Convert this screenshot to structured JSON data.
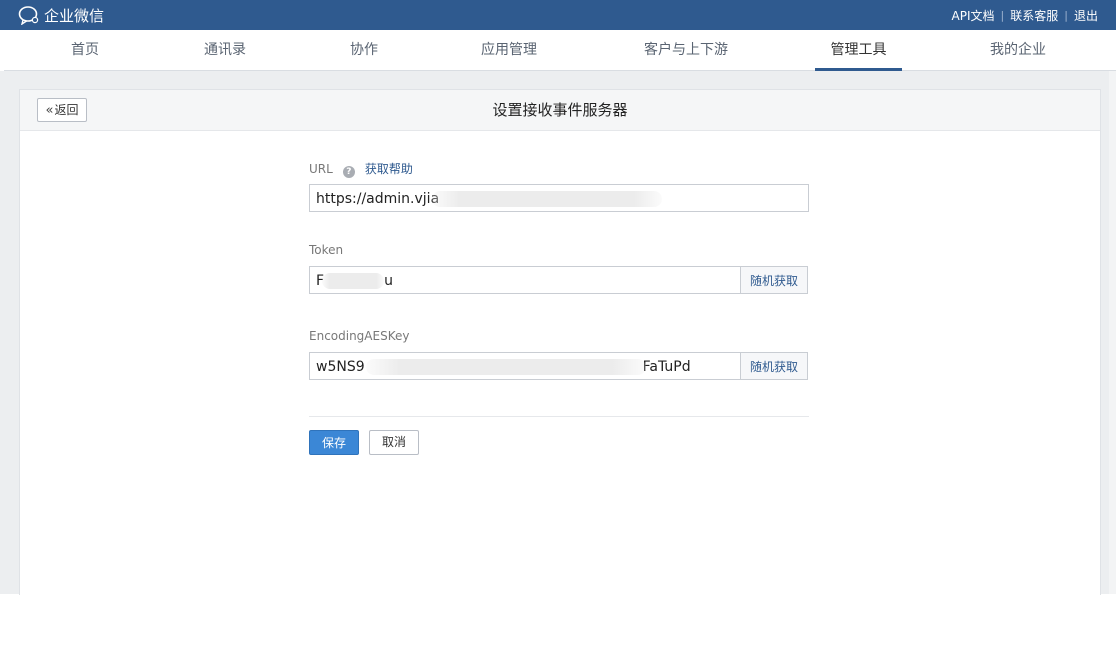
{
  "topbar": {
    "brand": "企业微信",
    "links": [
      "API文档",
      "联系客服",
      "退出"
    ],
    "separator": "|"
  },
  "nav": {
    "items": [
      {
        "label": "首页"
      },
      {
        "label": "通讯录"
      },
      {
        "label": "协作"
      },
      {
        "label": "应用管理"
      },
      {
        "label": "客户与上下游"
      },
      {
        "label": "管理工具"
      },
      {
        "label": "我的企业"
      }
    ],
    "active": "管理工具"
  },
  "panel": {
    "back_label": "返回",
    "title": "设置接收事件服务器"
  },
  "form": {
    "url": {
      "label": "URL",
      "help_link": "获取帮助",
      "value": "https://admin.vjia"
    },
    "token": {
      "label": "Token",
      "value_start": "F",
      "value_end": "u",
      "random_label": "随机获取"
    },
    "aeskey": {
      "label": "EncodingAESKey",
      "value_start": "w5NS9",
      "value_end": "FaTuPd",
      "random_label": "随机获取"
    },
    "save_label": "保存",
    "cancel_label": "取消"
  },
  "colors": {
    "topbar": "#2f5a8f",
    "primary_button": "#3b87d6",
    "link": "#2f5a8f"
  }
}
